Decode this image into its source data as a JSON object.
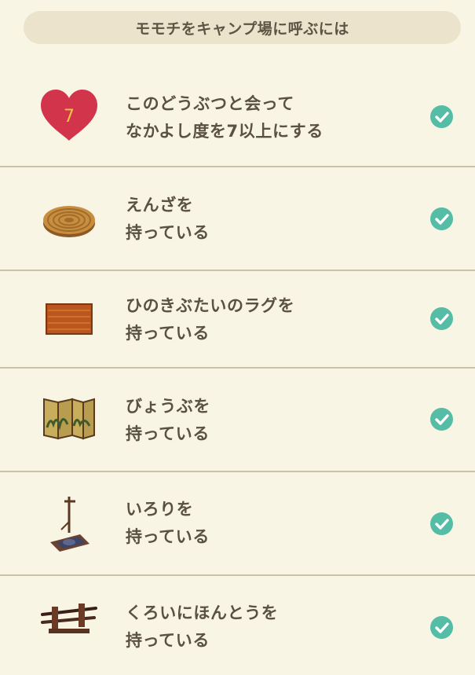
{
  "header": {
    "title": "モモチをキャンプ場に呼ぶには"
  },
  "conditions": [
    {
      "icon": "heart-icon",
      "heart_number": "7",
      "line1": "このどうぶつと会って",
      "line2": "なかよし度を7以上にする",
      "completed": true
    },
    {
      "icon": "cushion-icon",
      "line1": "えんざを",
      "line2": "持っている",
      "completed": true
    },
    {
      "icon": "rug-icon",
      "line1": "ひのきぶたいのラグを",
      "line2": "持っている",
      "completed": true
    },
    {
      "icon": "folding-screen-icon",
      "line1": "びょうぶを",
      "line2": "持っている",
      "completed": true
    },
    {
      "icon": "hearth-icon",
      "line1": "いろりを",
      "line2": "持っている",
      "completed": true
    },
    {
      "icon": "sword-rack-icon",
      "line1": "くろいにほんとうを",
      "line2": "持っている",
      "completed": true
    }
  ],
  "colors": {
    "background": "#f8f5e4",
    "header_background": "#ebe3cb",
    "text": "#5b5142",
    "divider": "#c9c2a7",
    "check": "#55bca6",
    "heart": "#d2344b",
    "heart_number": "#f2c443"
  }
}
